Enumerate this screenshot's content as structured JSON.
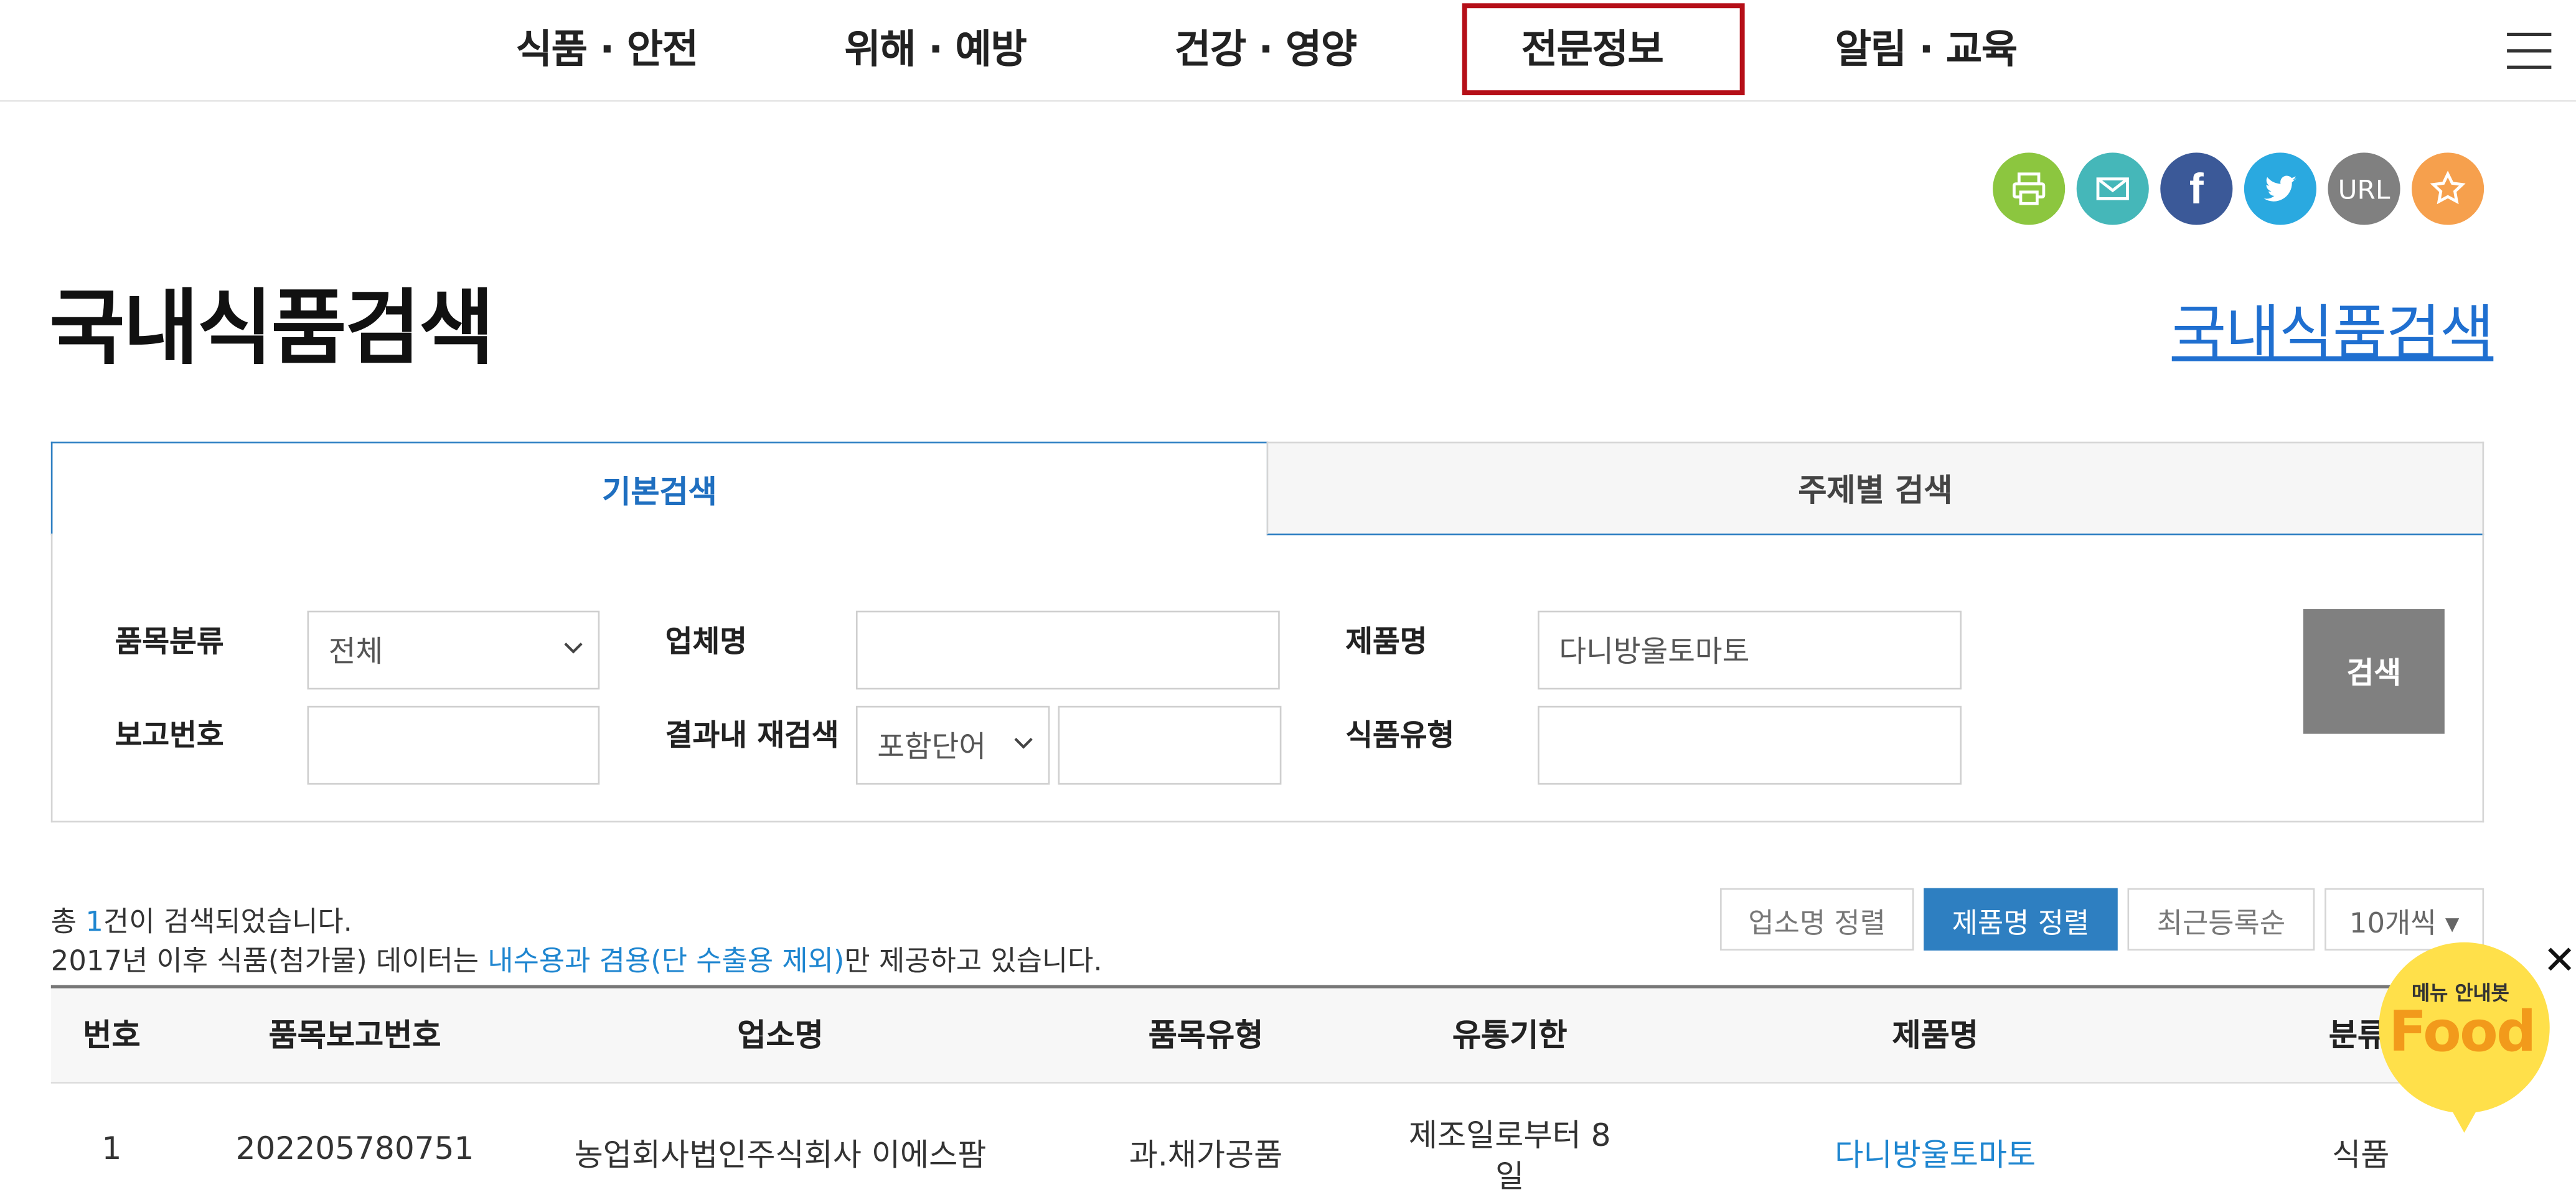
{
  "nav": {
    "items": [
      "식품 · 안전",
      "위해 · 예방",
      "건강 · 영양",
      "전문정보",
      "알림 · 교육"
    ]
  },
  "share": {
    "url_label": "URL",
    "colors": {
      "print": "#8cc63f",
      "mail": "#45b7b9",
      "facebook": "#3b5998",
      "twitter": "#2aa9e0",
      "url": "#808080",
      "favorite": "#f6a04d"
    }
  },
  "page": {
    "title": "국내식품검색",
    "title_link": "국내식품검색"
  },
  "tabs": {
    "basic": "기본검색",
    "topic": "주제별 검색"
  },
  "form": {
    "category_label": "품목분류",
    "category_value": "전체",
    "company_label": "업체명",
    "company_value": "",
    "product_label": "제품명",
    "product_value": "다니방울토마토",
    "report_label": "보고번호",
    "report_value": "",
    "refine_label": "결과내 재검색",
    "refine_option": "포함단어",
    "refine_value": "",
    "food_type_label": "식품유형",
    "food_type_value": "",
    "search_button": "검색"
  },
  "results": {
    "summary_prefix": "총 ",
    "summary_count": "1",
    "summary_suffix": "건이 검색되었습니다.",
    "notice_prefix": "2017년 이후 식품(첨가물) 데이터는 ",
    "notice_highlight": "내수용과 겸용(단 수출용 제외)",
    "notice_suffix": "만 제공하고 있습니다.",
    "sort_company": "업소명 정렬",
    "sort_product": "제품명 정렬",
    "sort_recent": "최근등록순",
    "page_size": "10개씩 ▾"
  },
  "table": {
    "headers": [
      "번호",
      "품목보고번호",
      "업소명",
      "품목유형",
      "유통기한",
      "제품명",
      "분류"
    ],
    "rows": [
      {
        "no": "1",
        "report_no": "202205780751",
        "company": "농업회사법인주식회사 이에스팜",
        "type": "과.채가공품",
        "shelf_life_1": "제조일로부터 8",
        "shelf_life_2": "일",
        "product": "다니방울토마토",
        "class": "식품"
      }
    ]
  },
  "food_menu": {
    "small": "메뉴 안내봇",
    "big": "Food",
    "close": "✕"
  }
}
